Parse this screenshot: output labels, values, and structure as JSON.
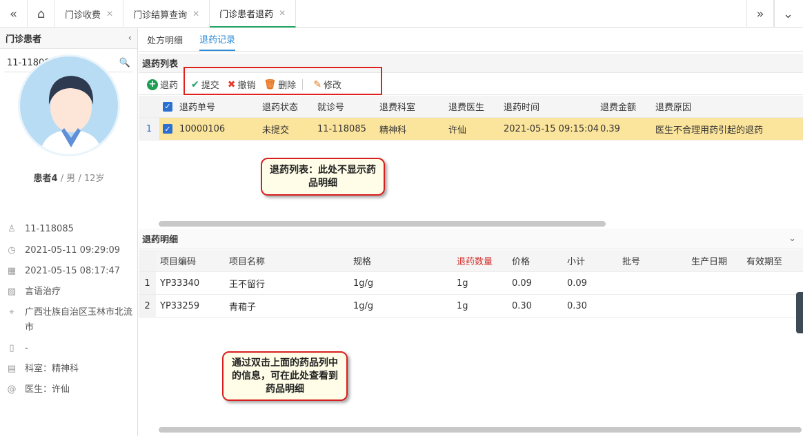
{
  "top_tabs": [
    {
      "label": "门诊收费"
    },
    {
      "label": "门诊结算查询"
    },
    {
      "label": "门诊患者退药"
    }
  ],
  "left": {
    "title": "门诊患者",
    "search_value": "11-118085",
    "patient_name": "患者4",
    "patient_sex_age": " / 男 / 12岁",
    "info": [
      {
        "icon": "user-icon",
        "text": "11-118085"
      },
      {
        "icon": "clock-icon",
        "text": "2021-05-11 09:29:09"
      },
      {
        "icon": "calendar-icon",
        "text": "2021-05-15 08:17:47"
      },
      {
        "icon": "image-icon",
        "text": "言语治疗"
      },
      {
        "icon": "location-icon",
        "text": "广西壮族自治区玉林市北流市"
      },
      {
        "icon": "phone-icon",
        "text": "-"
      },
      {
        "icon": "department-icon",
        "text": "科室：精神科"
      },
      {
        "icon": "at-icon",
        "text": "医生：许仙"
      }
    ]
  },
  "sub_tabs": [
    {
      "label": "处方明细"
    },
    {
      "label": "退药记录"
    }
  ],
  "refund_list": {
    "title": "退药列表",
    "toolbar": {
      "refund": "退药",
      "submit": "提交",
      "revoke": "撤销",
      "delete": "删除",
      "modify": "修改"
    },
    "columns": [
      "退药单号",
      "退药状态",
      "就诊号",
      "退费科室",
      "退费医生",
      "退药时间",
      "退费金额",
      "退费原因"
    ],
    "rows": [
      {
        "no": "1",
        "cells": [
          "10000106",
          "未提交",
          "11-118085",
          "精神科",
          "许仙",
          "2021-05-15 09:15:04",
          "0.39",
          "医生不合理用药引起的退药"
        ]
      }
    ]
  },
  "refund_detail": {
    "title": "退药明细",
    "columns": [
      "项目编码",
      "项目名称",
      "规格",
      "退药数量",
      "价格",
      "小计",
      "批号",
      "生产日期",
      "有效期至"
    ],
    "rows": [
      {
        "no": "1",
        "cells": [
          "YP33340",
          "王不留行",
          "1g/g",
          "1g",
          "0.09",
          "0.09",
          "",
          "",
          ""
        ]
      },
      {
        "no": "2",
        "cells": [
          "YP33259",
          "青葙子",
          "1g/g",
          "1g",
          "0.30",
          "0.30",
          "",
          "",
          ""
        ]
      }
    ]
  },
  "annotations": {
    "list_note": "退药列表：此处不显示药品明细",
    "detail_note": "通过双击上面的药品列中的信息，可在此处查看到药品明细"
  },
  "colors": {
    "accent": "#2b8ad8",
    "highlight_row": "#fbe49b",
    "red": "#e0221e",
    "qty_header": "#d43030"
  }
}
